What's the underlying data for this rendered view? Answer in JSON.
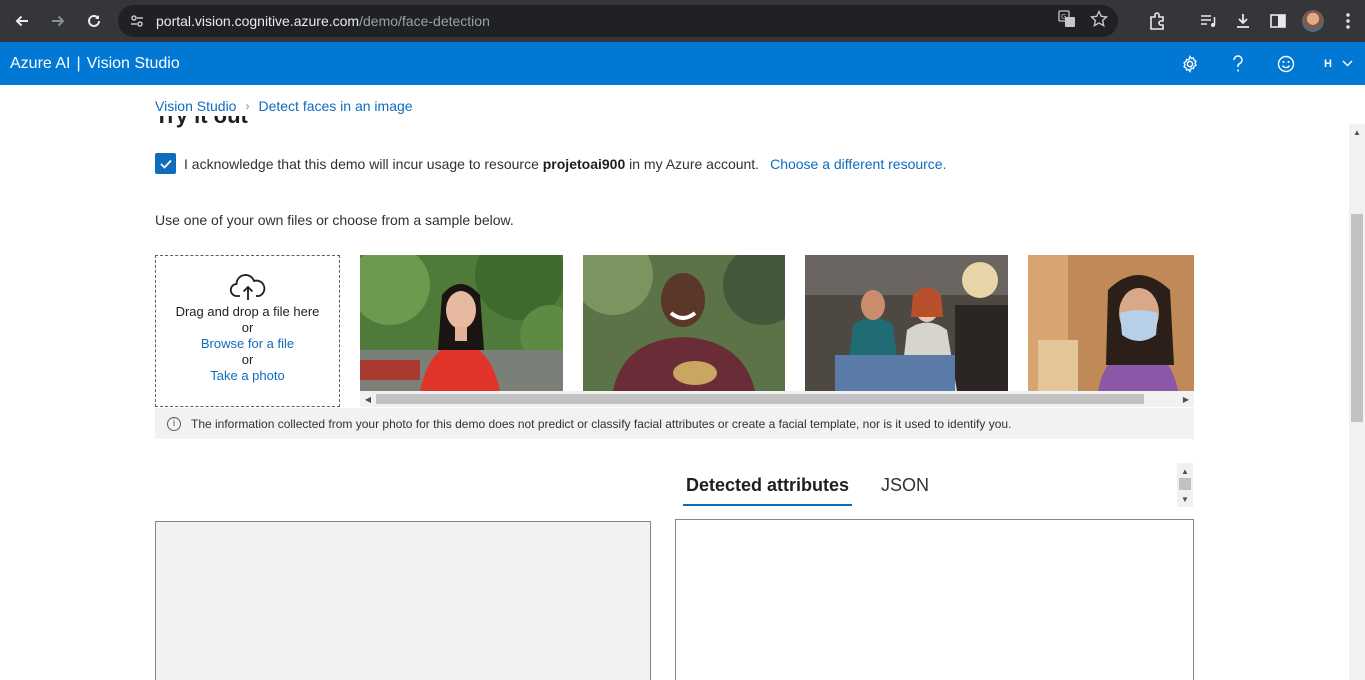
{
  "browser": {
    "url_host": "portal.vision.cognitive.azure.com",
    "url_path": "/demo/face-detection"
  },
  "header": {
    "brand": "Azure AI",
    "product": "Vision Studio",
    "user_initial": "H"
  },
  "breadcrumb": {
    "home": "Vision Studio",
    "current": "Detect faces in an image"
  },
  "section": {
    "heading": "Try it out"
  },
  "acknowledge": {
    "checked": true,
    "text_before": "I acknowledge that this demo will incur usage to resource",
    "resource": "projetoai900",
    "text_after": "in my Azure account.",
    "change_link": "Choose a different resource."
  },
  "instructions": "Use one of your own files or choose from a sample below.",
  "upload": {
    "drag_text": "Drag and drop a file here",
    "or1": "or",
    "browse": "Browse for a file",
    "or2": "or",
    "take_photo": "Take a photo"
  },
  "notice": "The information collected from your photo for this demo does not predict or classify facial attributes or create a facial template, nor is it used to identify you.",
  "tabs": [
    {
      "label": "Detected attributes",
      "active": true
    },
    {
      "label": "JSON",
      "active": false
    }
  ]
}
